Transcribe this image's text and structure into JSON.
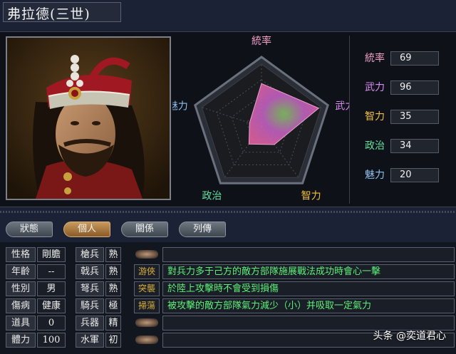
{
  "title": "弗拉德(三世)",
  "stats": [
    {
      "label": "統率",
      "value": "69",
      "color": "#f0a0c8"
    },
    {
      "label": "武力",
      "value": "96",
      "color": "#d890f0"
    },
    {
      "label": "智力",
      "value": "35",
      "color": "#f0c040"
    },
    {
      "label": "政治",
      "value": "34",
      "color": "#60e0a0"
    },
    {
      "label": "魅力",
      "value": "20",
      "color": "#90c0f0"
    }
  ],
  "radar": {
    "axes": [
      "統率",
      "武力",
      "智力",
      "政治",
      "魅力"
    ],
    "values": [
      69,
      96,
      35,
      34,
      20
    ],
    "max": 100
  },
  "tabs": [
    "狀態",
    "個人",
    "關係",
    "列傳"
  ],
  "active_tab": "個人",
  "personal": [
    {
      "label": "性格",
      "value": "剛膽"
    },
    {
      "label": "年齡",
      "value": "--"
    },
    {
      "label": "性別",
      "value": "男"
    },
    {
      "label": "傷病",
      "value": "健康"
    },
    {
      "label": "道具",
      "value": "0"
    },
    {
      "label": "體力",
      "value": "100"
    }
  ],
  "troops": [
    {
      "label": "槍兵",
      "value": "熟"
    },
    {
      "label": "戟兵",
      "value": "熟"
    },
    {
      "label": "弩兵",
      "value": "熟"
    },
    {
      "label": "騎兵",
      "value": "極"
    },
    {
      "label": "兵器",
      "value": "精"
    },
    {
      "label": "水軍",
      "value": "初"
    }
  ],
  "skills": [
    {
      "name": "",
      "desc": ""
    },
    {
      "name": "游俠",
      "desc": "對兵力多于己方的敵方部隊施展戰法成功時會心一擊"
    },
    {
      "name": "突襲",
      "desc": "於陸上攻擊時不會受到損傷"
    },
    {
      "name": "掃蕩",
      "desc": "被攻擊的敵方部隊氣力減少（小）并吸取一定氣力"
    },
    {
      "name": "",
      "desc": ""
    },
    {
      "name": "",
      "desc": ""
    }
  ],
  "watermark": "头条 @奕道君心",
  "colors": {
    "skill_name": "#d8b040",
    "skill_desc": "#5ef07a",
    "active_tab": "#b07a3c"
  }
}
